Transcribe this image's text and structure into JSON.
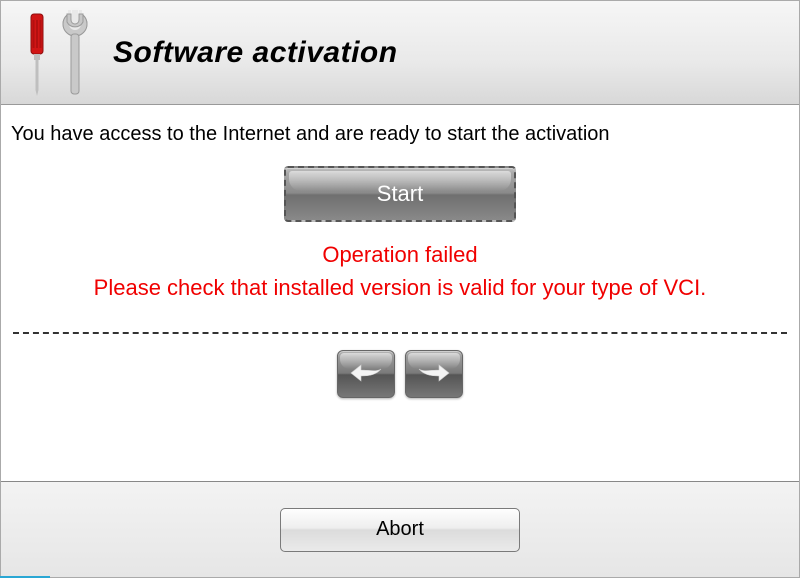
{
  "header": {
    "title": "Software activation"
  },
  "main": {
    "instruction": "You have access to the Internet and are ready to start the activation",
    "start_label": "Start",
    "error_line1": "Operation failed",
    "error_line2": "Please check that installed version is valid for your type of VCI."
  },
  "footer": {
    "abort_label": "Abort"
  },
  "icons": {
    "tools": "screwdriver-wrench-icon",
    "back": "arrow-left-icon",
    "forward": "arrow-right-icon"
  },
  "colors": {
    "error": "#f00000",
    "accent": "#2aa7d4"
  }
}
